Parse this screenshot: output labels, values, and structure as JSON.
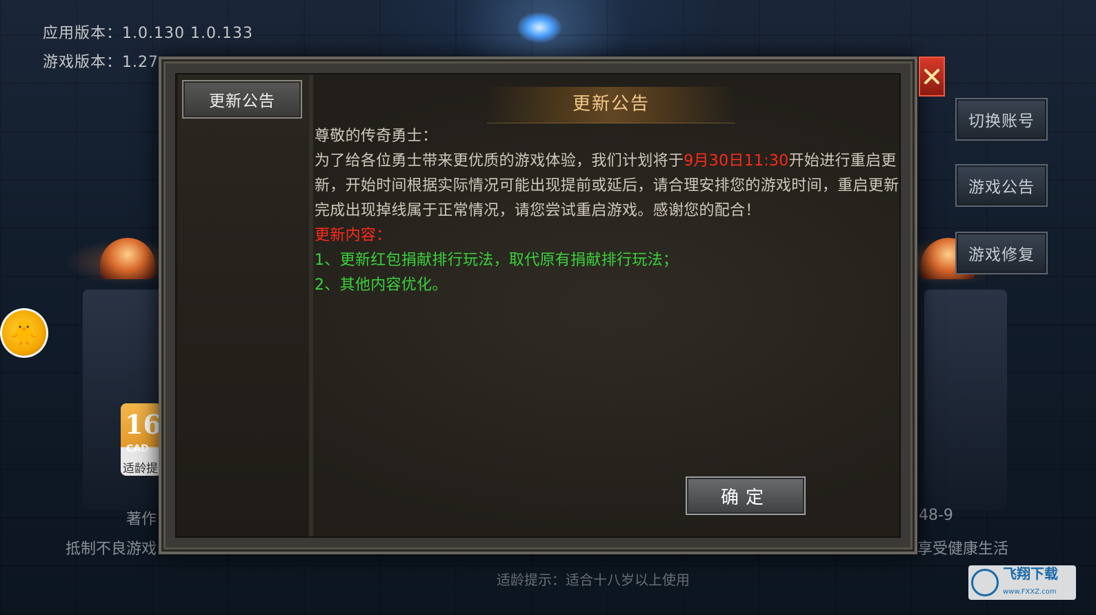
{
  "app": {
    "app_version": "应用版本：1.0.130  1.0.133",
    "game_version": "游戏版本：1.27"
  },
  "side_buttons": [
    {
      "label": "切换账号"
    },
    {
      "label": "游戏公告"
    },
    {
      "label": "游戏修复"
    }
  ],
  "age_badge": {
    "number": "16",
    "cad": "CAD",
    "caption": "适龄提"
  },
  "footer": {
    "copyright_left": "著作",
    "copyright_right": "48-9",
    "health_left": "抵制不良游戏",
    "health_right": "享受健康生活",
    "age_tip": "适龄提示：适合十八岁以上使用"
  },
  "dialog": {
    "tab_label": "更新公告",
    "title": "更新公告",
    "greeting": "尊敬的传奇勇士：",
    "para_pre": "为了给各位勇士带来更优质的游戏体验，我们计划将于",
    "para_time": "9月30日11:30",
    "para_post": "开始进行重启更新，开始时间根据实际情况可能出现提前或延后，请合理安排您的游戏时间，重启更新完成出现掉线属于正常情况，请您尝试重启游戏。感谢您的配合！",
    "content_heading": "更新内容：",
    "items": [
      "1、更新红包捐献排行玩法，取代原有捐献排行玩法；",
      "2、其他内容优化。"
    ],
    "ok_label": "确定",
    "close_icon": "close-x-icon"
  },
  "watermark": {
    "text": "飞翔下载",
    "url": "www.FXXZ.com"
  },
  "colors": {
    "highlight_red": "#ff2a1a",
    "list_green": "#3ad23a",
    "title_gold": "#f2c98a"
  }
}
